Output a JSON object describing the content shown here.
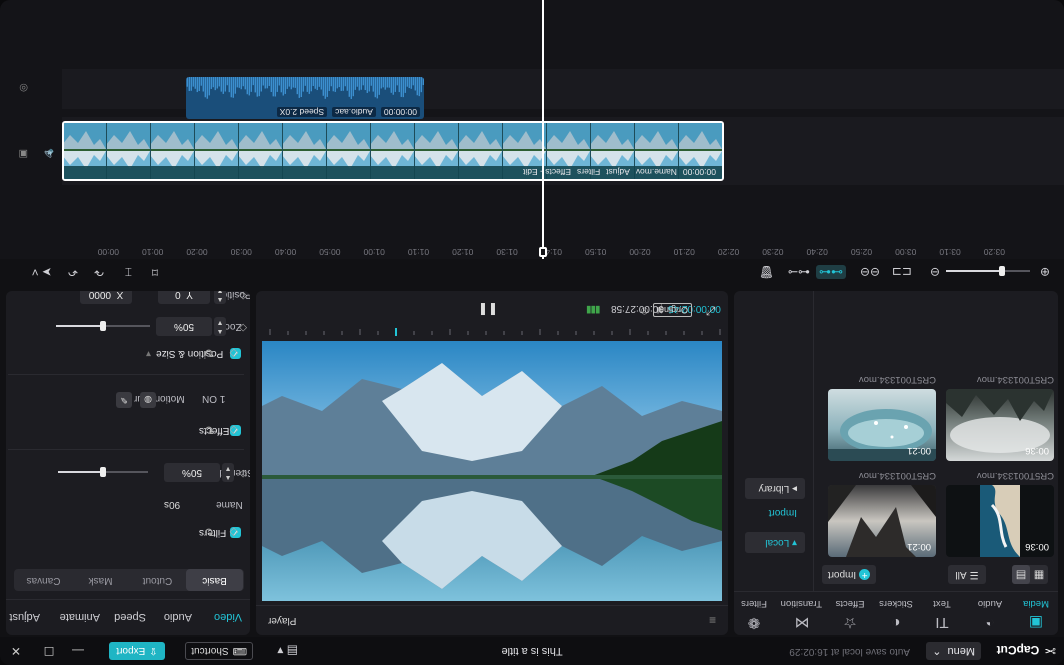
{
  "titlebar": {
    "app_name": "CapCut",
    "menu_label": "Menu",
    "autosave": "Auto save local at 16:02:29",
    "doc_title": "This is a title",
    "shortcut_label": "Shortcut",
    "export_label": "Export"
  },
  "media": {
    "tabs": [
      {
        "label": "Media",
        "icon": "media-icon"
      },
      {
        "label": "Audio",
        "icon": "audio-icon"
      },
      {
        "label": "Text",
        "icon": "text-icon"
      },
      {
        "label": "Stickers",
        "icon": "stickers-icon"
      },
      {
        "label": "Effects",
        "icon": "effects-icon"
      },
      {
        "label": "Transition",
        "icon": "transition-icon"
      },
      {
        "label": "Filters",
        "icon": "filters-icon"
      }
    ],
    "active_tab": "Media",
    "side": {
      "local": "Local",
      "import": "Import",
      "library": "Library"
    },
    "import_button": "Import",
    "sort_label": "All",
    "items": [
      {
        "name": "CR5T001334.mov",
        "duration": "00:21"
      },
      {
        "name": "CR5T001334.mov",
        "duration": "00:36"
      },
      {
        "name": "CR5T001334.mov",
        "duration": "00:21"
      },
      {
        "name": "CR5T001334.mov",
        "duration": "00:36"
      }
    ]
  },
  "player": {
    "title": "Player",
    "current_time": "00:00:02:45",
    "total_time": "00:00:27:58",
    "ratio_label": "Original"
  },
  "properties": {
    "tabs": [
      "Video",
      "Audio",
      "Speed",
      "Animate",
      "Adjust"
    ],
    "active_tab": "Video",
    "sub_tabs": [
      "Basic",
      "Cutout",
      "Mask",
      "Canvas"
    ],
    "active_sub_tab": "Basic",
    "filters": {
      "title": "Filters",
      "name_label": "Name",
      "name_value": "90s",
      "strength_label": "Strength",
      "strength_value": "50%",
      "strength_level": 0.5
    },
    "effects": {
      "title": "Effects",
      "motion_blur_label": "Motion Blur",
      "motion_blur_value": "1 ON"
    },
    "position_size": {
      "title": "Position & Size",
      "zoom_label": "Zoom",
      "zoom_value": "50%",
      "zoom_level": 0.5,
      "position_label": "Position",
      "pos_x_label": "X",
      "pos_x": "0000",
      "pos_y_label": "Y",
      "pos_y": "0"
    }
  },
  "timeline": {
    "ruler": [
      "00:00",
      "00:10",
      "00:20",
      "00:30",
      "00:40",
      "00:50",
      "01:00",
      "01:10",
      "01:20",
      "01:30",
      "01:40",
      "01:50",
      "02:00",
      "02:10",
      "02:20",
      "02:30",
      "02:40",
      "02:50",
      "03:00",
      "03:10",
      "03:20"
    ],
    "main_clip": {
      "labels": [
        "Effects - Edit",
        "Filters",
        "Adjust",
        "Name.mov",
        "00:00:00"
      ]
    },
    "audio_clip": {
      "labels": [
        "Speed 2.0X",
        "Audio.aac",
        "00:00:00"
      ]
    },
    "zoom_level": 0.67
  },
  "colors": {
    "accent": "#22c4d6",
    "export": "#1fb5c4",
    "audio_clip": "#1a4e7a",
    "video_clip": "#1d6b78"
  }
}
